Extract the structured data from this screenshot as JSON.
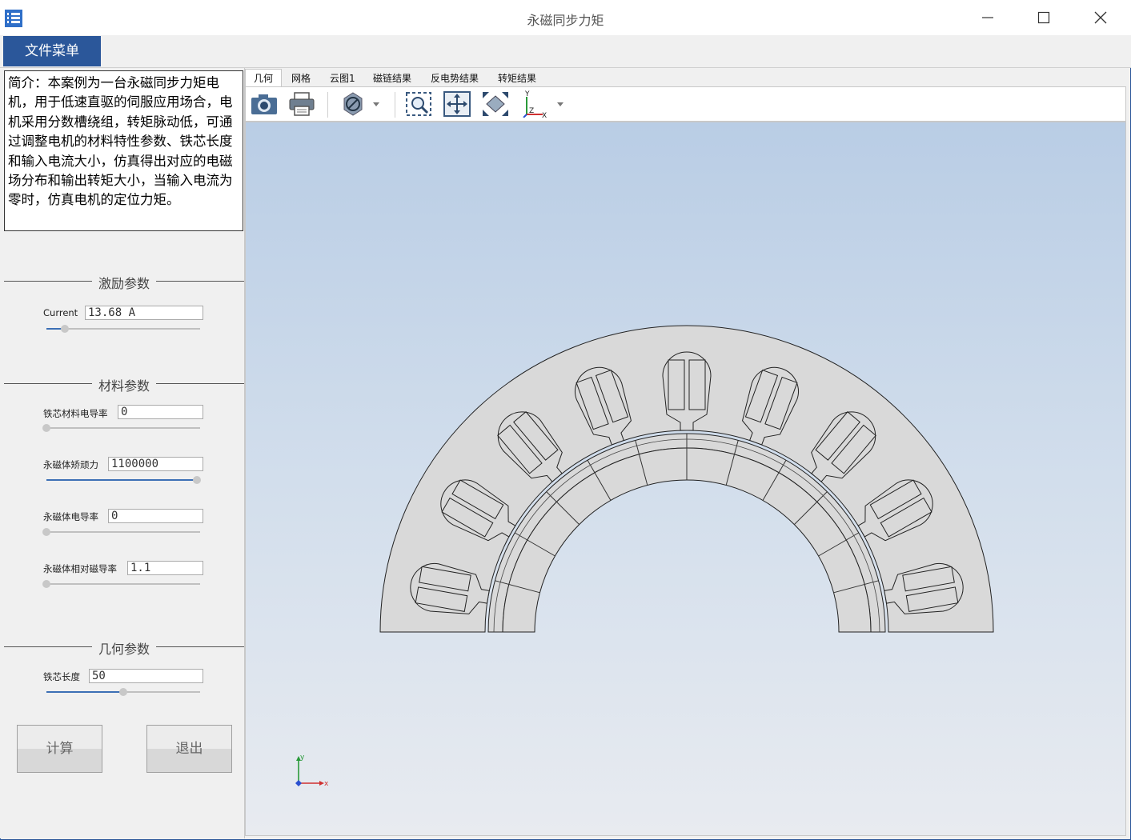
{
  "window": {
    "title": "永磁同步力矩"
  },
  "menu": {
    "file_menu": "文件菜单"
  },
  "intro": {
    "text": "简介：本案例为一台永磁同步力矩电机，用于低速直驱的伺服应用场合，电机采用分数槽绕组，转矩脉动低，可通过调整电机的材料特性参数、铁芯长度和输入电流大小，仿真得出对应的电磁场分布和输出转矩大小，当输入电流为零时，仿真电机的定位力矩。"
  },
  "sections": {
    "excitation": "激励参数",
    "material": "材料参数",
    "geometry": "几何参数"
  },
  "params": {
    "current": {
      "label": "Current",
      "value": "13.68 A",
      "level": 0.12
    },
    "core_conductivity": {
      "label": "铁芯材料电导率",
      "value": "0",
      "level": 0.0
    },
    "magnet_coercivity": {
      "label": "永磁体矫顽力",
      "value": "1100000",
      "level": 0.98
    },
    "magnet_conductivity": {
      "label": "永磁体电导率",
      "value": "0",
      "level": 0.0
    },
    "magnet_permeability": {
      "label": "永磁体相对磁导率",
      "value": "1.1",
      "level": 0.0
    },
    "core_length": {
      "label": "铁芯长度",
      "value": "50",
      "level": 0.5
    }
  },
  "buttons": {
    "compute": "计算",
    "exit": "退出"
  },
  "tabs": [
    "几何",
    "网格",
    "云图1",
    "磁链结果",
    "反电势结果",
    "转矩结果"
  ],
  "toolbar": [
    "camera-icon",
    "print-icon",
    "render-mode-icon",
    "zoom-box-icon",
    "fit-view-icon",
    "zoom-all-icon",
    "axis-view-icon"
  ],
  "axes": {
    "x": "x",
    "y": "y"
  },
  "colors": {
    "accent": "#2b579a",
    "part_fill": "#d9d9d9"
  }
}
